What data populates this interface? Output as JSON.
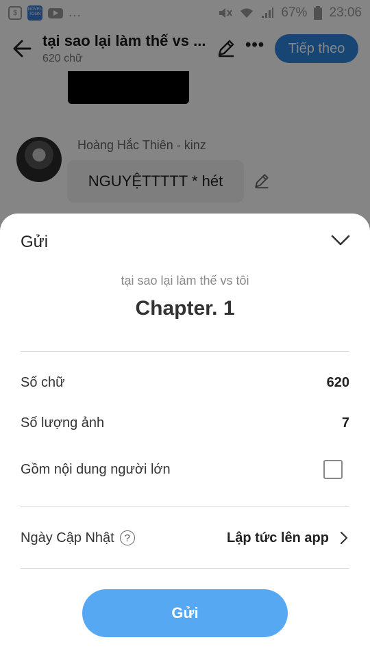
{
  "status_bar": {
    "novel_icon_text": "NOVEL TOON",
    "dots": "...",
    "battery_percent": "67%",
    "time": "23:06"
  },
  "app_bar": {
    "title": "tại sao lại làm thế vs ...",
    "subtitle": "620 chữ",
    "more_label": "•••",
    "next_button": "Tiếp theo"
  },
  "content": {
    "speaker_name": "Hoàng Hắc Thiên - kinz",
    "message": "NGUYỆTTTTT * hét"
  },
  "sheet": {
    "title": "Gửi",
    "story_title": "tại sao lại làm thế vs tôi",
    "chapter_title": "Chapter. 1",
    "word_count_label": "Số chữ",
    "word_count_value": "620",
    "image_count_label": "Số lượng ảnh",
    "image_count_value": "7",
    "adult_content_label": "Gồm nội dung người lớn",
    "adult_content_checked": false,
    "update_date_label": "Ngày Cập Nhật",
    "help_symbol": "?",
    "update_date_value": "Lập tức lên app",
    "send_button": "Gửi"
  },
  "colors": {
    "primary": "#2e86de",
    "send_button": "#57a8f3",
    "overlay": "rgba(0,0,0,0.48)"
  }
}
